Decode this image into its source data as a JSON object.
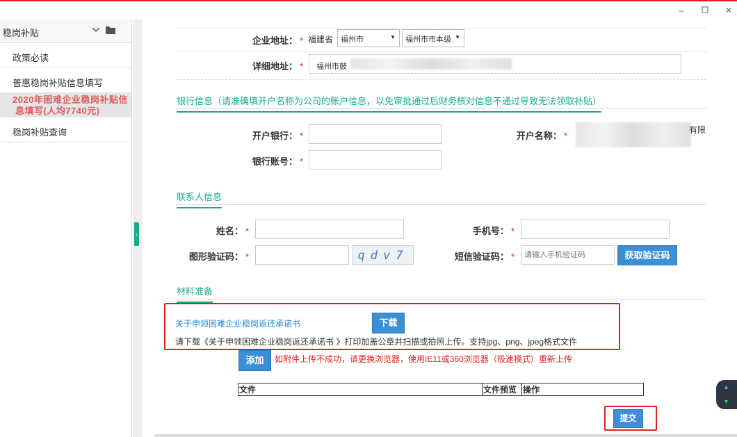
{
  "window": {
    "minimize_icon": "minimize-icon",
    "maximize_icon": "maximize-icon",
    "close_icon": "close-icon"
  },
  "sidebar": {
    "title": "稳岗补贴",
    "items": [
      {
        "label": "政策必读"
      },
      {
        "label": "普惠稳岗补贴信息填写"
      },
      {
        "label_line1": "2020年困难企业稳岗补贴信",
        "label_line2": "息填写(人均7740元)"
      },
      {
        "label": "稳岗补贴查询"
      }
    ]
  },
  "company": {
    "address_label": "企业地址：",
    "province": "福建省",
    "city": "福州市",
    "district": "福州市市本级",
    "detail_label": "详细地址：",
    "detail_value": "福州市鼓"
  },
  "bank": {
    "section_title": "银行信息（请准确填开户名称为公司的账户信息，以免审批通过后财务核对信息不通过导致无法领取补贴）",
    "bank_label": "开户银行：",
    "account_name_label": "开户名称：",
    "account_name_suffix": "有限",
    "account_no_label": "银行账号："
  },
  "contact": {
    "section_title": "联系人信息",
    "name_label": "姓名：",
    "phone_label": "手机号：",
    "captcha_label": "图形验证码：",
    "captcha_text": "qdv7",
    "sms_label": "短信验证码：",
    "sms_placeholder": "请输入手机验证码",
    "sms_button": "获取验证码"
  },
  "materials": {
    "section_title": "材料准备",
    "doc_link": "关于申领困难企业稳岗返还承诺书",
    "download_button": "下载",
    "instruction": "请下载《关于申领困难企业稳岗返还承诺书 》打印加盖公章并扫描或拍照上传。支持jpg、png、jpeg格式文件",
    "add_button": "添加",
    "warning": "如附件上传不成功，请更换浏览器，使用IE11或360浏览器（极速模式）重新上传",
    "table_headers": [
      "文件",
      "文件预览",
      "操作"
    ],
    "submit_button": "提交"
  },
  "colors": {
    "accent": "#1aaa8a",
    "button": "#3d8fd4",
    "required": "#e02020",
    "highlight": "#e02020"
  }
}
